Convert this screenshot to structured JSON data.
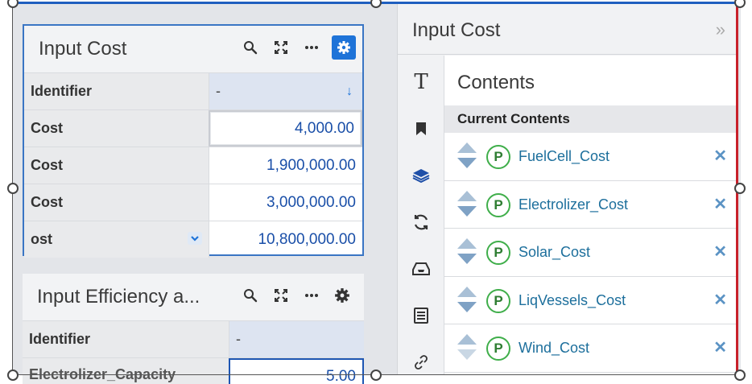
{
  "widget1": {
    "title": "Input Cost",
    "header_label": "Identifier",
    "header_value": "-",
    "rows": [
      {
        "label": "Cost",
        "value": "4,000.00"
      },
      {
        "label": "Cost",
        "value": "1,900,000.00"
      },
      {
        "label": "Cost",
        "value": "3,000,000.00"
      },
      {
        "label": "ost",
        "value": "10,800,000.00"
      }
    ]
  },
  "widget2": {
    "title": "Input Efficiency a...",
    "header_label": "Identifier",
    "header_value": "-",
    "partial_row_label": "Electrolizer_Capacity",
    "partial_row_value": "5.00"
  },
  "panel": {
    "title": "Input Cost",
    "collapse": "»",
    "contents_title": "Contents",
    "current_contents": "Current Contents",
    "items": [
      {
        "badge": "P",
        "name": "FuelCell_Cost"
      },
      {
        "badge": "P",
        "name": "Electrolizer_Cost"
      },
      {
        "badge": "P",
        "name": "Solar_Cost"
      },
      {
        "badge": "P",
        "name": "LiqVessels_Cost"
      },
      {
        "badge": "P",
        "name": "Wind_Cost"
      }
    ],
    "rail_icons": [
      "text-icon",
      "bookmark-icon",
      "layers-icon",
      "refresh-icon",
      "inbox-icon",
      "list-icon",
      "link-icon"
    ]
  },
  "icons": {
    "search": "🔍",
    "expand": "⛶",
    "more": "···",
    "gear": "⚙",
    "down_arrow": "↓",
    "chevron": "⌄",
    "remove": "✕"
  },
  "colors": {
    "accent": "#1e73d8",
    "value_text": "#1a4fa8",
    "badge_green": "#3fae4a",
    "selection_right": "#c8202a",
    "selection_top": "#1f5fbf"
  }
}
